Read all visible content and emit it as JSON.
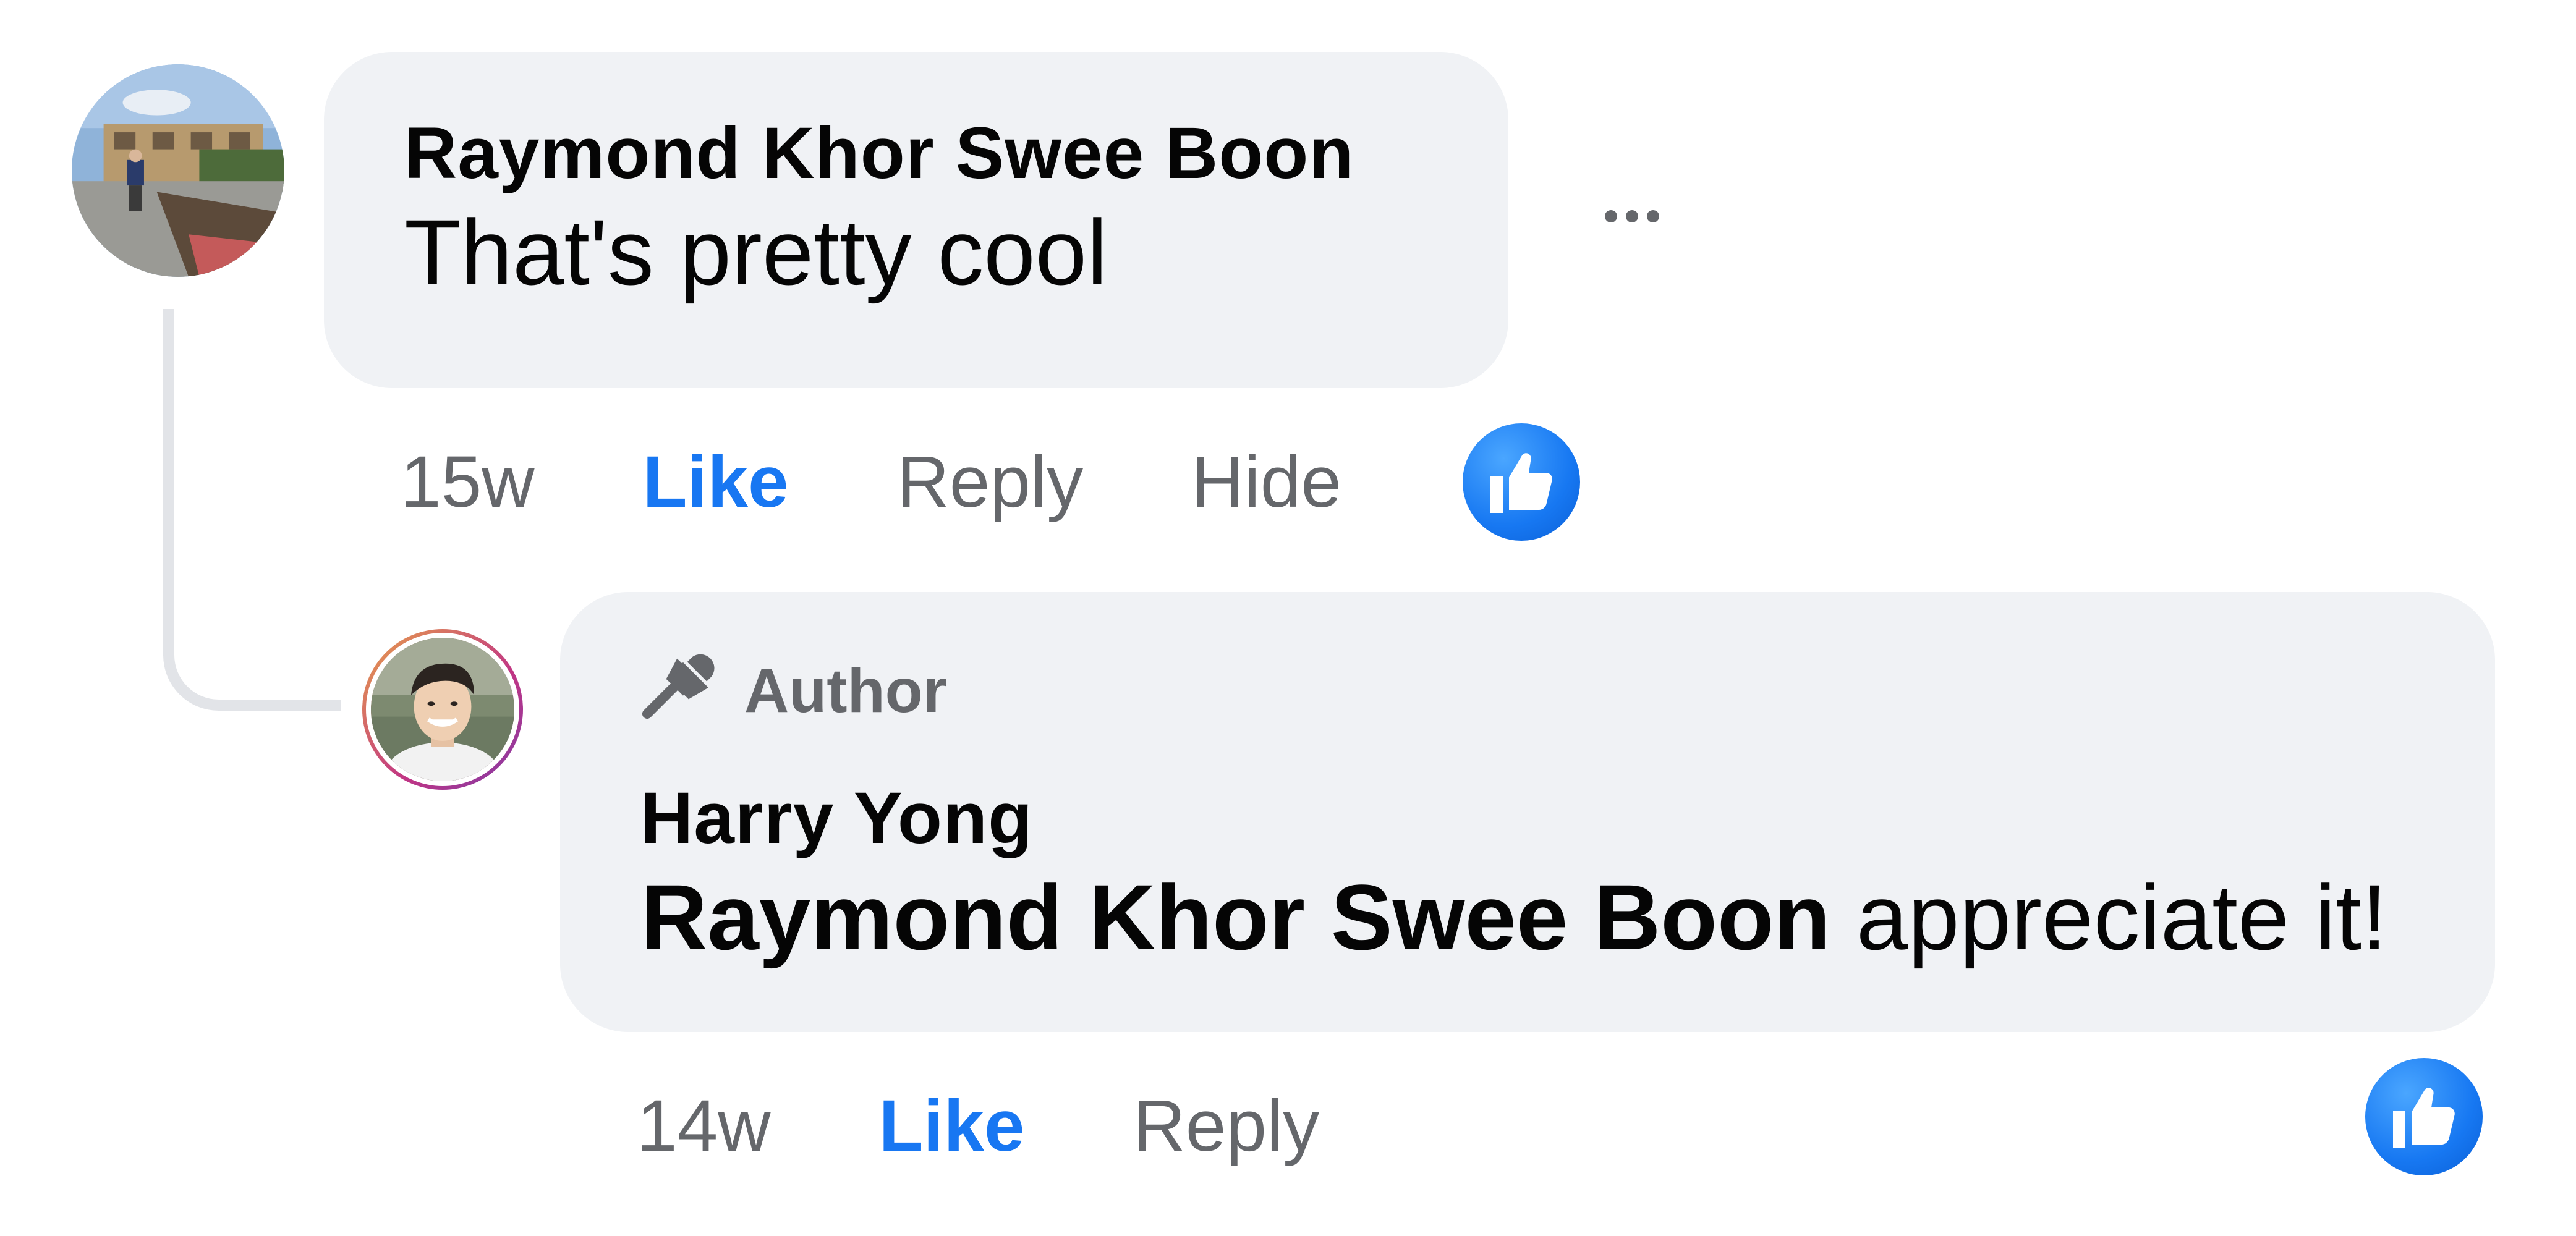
{
  "comment": {
    "author": "Raymond Khor Swee Boon",
    "text": "That's pretty cool",
    "time": "15w",
    "actions": {
      "like": "Like",
      "reply": "Reply",
      "hide": "Hide"
    },
    "reaction_icon": "thumbs-up-icon",
    "more_icon": "more-horizontal-icon"
  },
  "reply": {
    "badge": "Author",
    "badge_icon": "microphone-icon",
    "author": "Harry Yong",
    "mention": "Raymond Khor Swee Boon",
    "text": " appreciate it!",
    "time": "14w",
    "actions": {
      "like": "Like",
      "reply": "Reply"
    },
    "reaction_icon": "thumbs-up-icon"
  },
  "colors": {
    "like_blue": "#1877f2",
    "bubble_bg": "#f0f2f5",
    "muted_text": "#65676b",
    "primary_text": "#050505"
  }
}
